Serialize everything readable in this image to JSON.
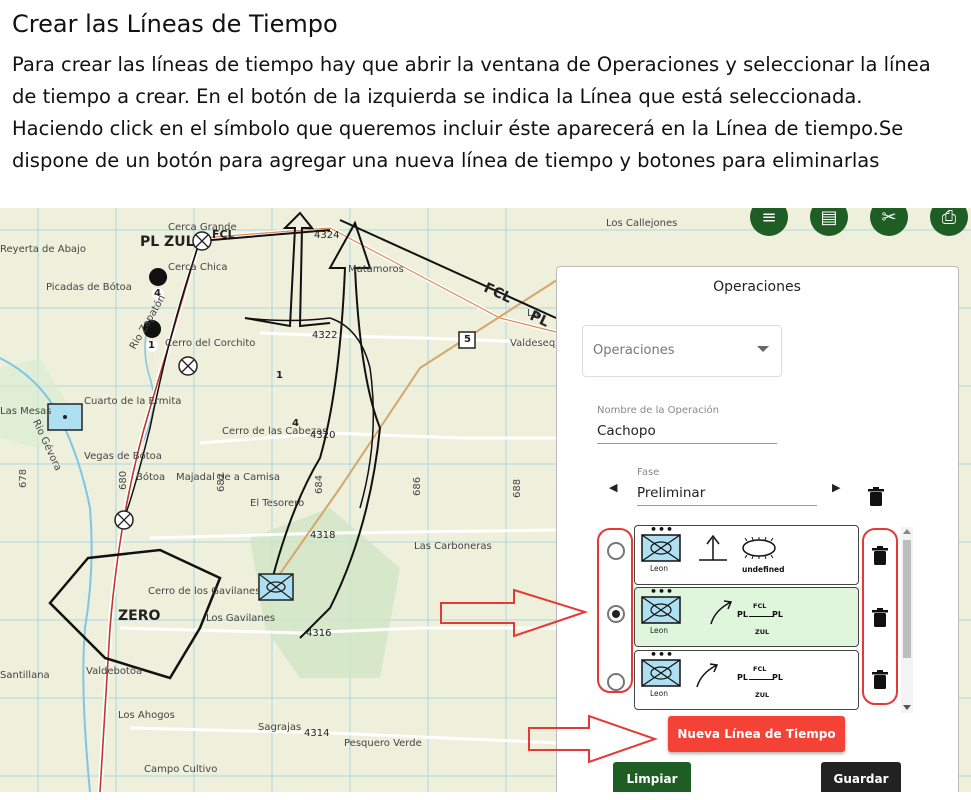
{
  "document": {
    "title": "Crear las Líneas de Tiempo",
    "body": "Para crear las líneas de tiempo hay que abrir la ventana de Operaciones y seleccionar la línea de tiempo a crear. En el botón de la izquierda se indica la Línea que está seleccionada. Haciendo click en el símbolo que queremos incluir éste aparecerá en la Línea de tiempo.Se dispone de un botón para agregar una nueva línea de tiempo y botones para eliminarlas"
  },
  "map": {
    "places": [
      "Reyerta de Abajo",
      "Cerca Grande",
      "Cerca Chica",
      "Picadas de Bótoa",
      "Los Callejones",
      "Matamoros",
      "Valdesequera",
      "Cerro del Corchito",
      "Cuarto de la Ermita",
      "Las Mesas",
      "Cerro de las Cabezas",
      "Vegas de Bótoa",
      "Bótoa",
      "Majadal de a Camisa",
      "El Tesorero",
      "Las Carboneras",
      "Cerro de los Gavilanes",
      "Los Gavilanes",
      "Los Ahogos",
      "Sagrajas",
      "Pesquero Verde",
      "Campo Cultivo",
      "Valdebotoa",
      "Santillana",
      "Rio Zapatón",
      "Rio Gévora",
      "ZERO",
      "La"
    ],
    "roads": [
      "4324",
      "4322",
      "4320",
      "4318",
      "4316",
      "4314",
      "5"
    ],
    "grid_numbers": [
      "678",
      "680",
      "682",
      "684",
      "686",
      "688"
    ],
    "tactical": {
      "pl_zul": "PL ZUL",
      "fcl": "FCL",
      "fcl_pl": "FCL",
      "pl_short": "PL",
      "markers": [
        "4",
        "1",
        "1",
        "4"
      ]
    }
  },
  "toolbar": {
    "icons": [
      "menu-icon",
      "document-icon",
      "tools-icon",
      "printer-icon"
    ],
    "glyphs": [
      "≡",
      "▤",
      "✂",
      "⎙"
    ]
  },
  "panel": {
    "title": "Operaciones",
    "select_value": "Operaciones",
    "op_name_label": "Nombre de la Operación",
    "op_name_value": "Cachopo",
    "fase_label": "Fase",
    "fase_value": "Preliminar",
    "fase_prev": "◀",
    "fase_next": "▶",
    "timelines": [
      {
        "unit": "Leon",
        "dots": "•••",
        "label": "undefined",
        "selected": false
      },
      {
        "unit": "Leon",
        "dots": "•••",
        "pl": "PL",
        "fcl": "FCL",
        "zul": "ZUL",
        "selected": true
      },
      {
        "unit": "Leon",
        "dots": "•••",
        "pl": "PL",
        "fcl": "FCL",
        "zul": "ZUL",
        "selected": false
      }
    ],
    "new_button": "Nueva Línea de Tiempo",
    "clear_button": "Limpiar",
    "save_button": "Guardar"
  },
  "colors": {
    "accent_green": "#1e5e24",
    "new_button": "#f44336",
    "annotation_red": "#e53935",
    "selected_row": "#dff5dc"
  }
}
